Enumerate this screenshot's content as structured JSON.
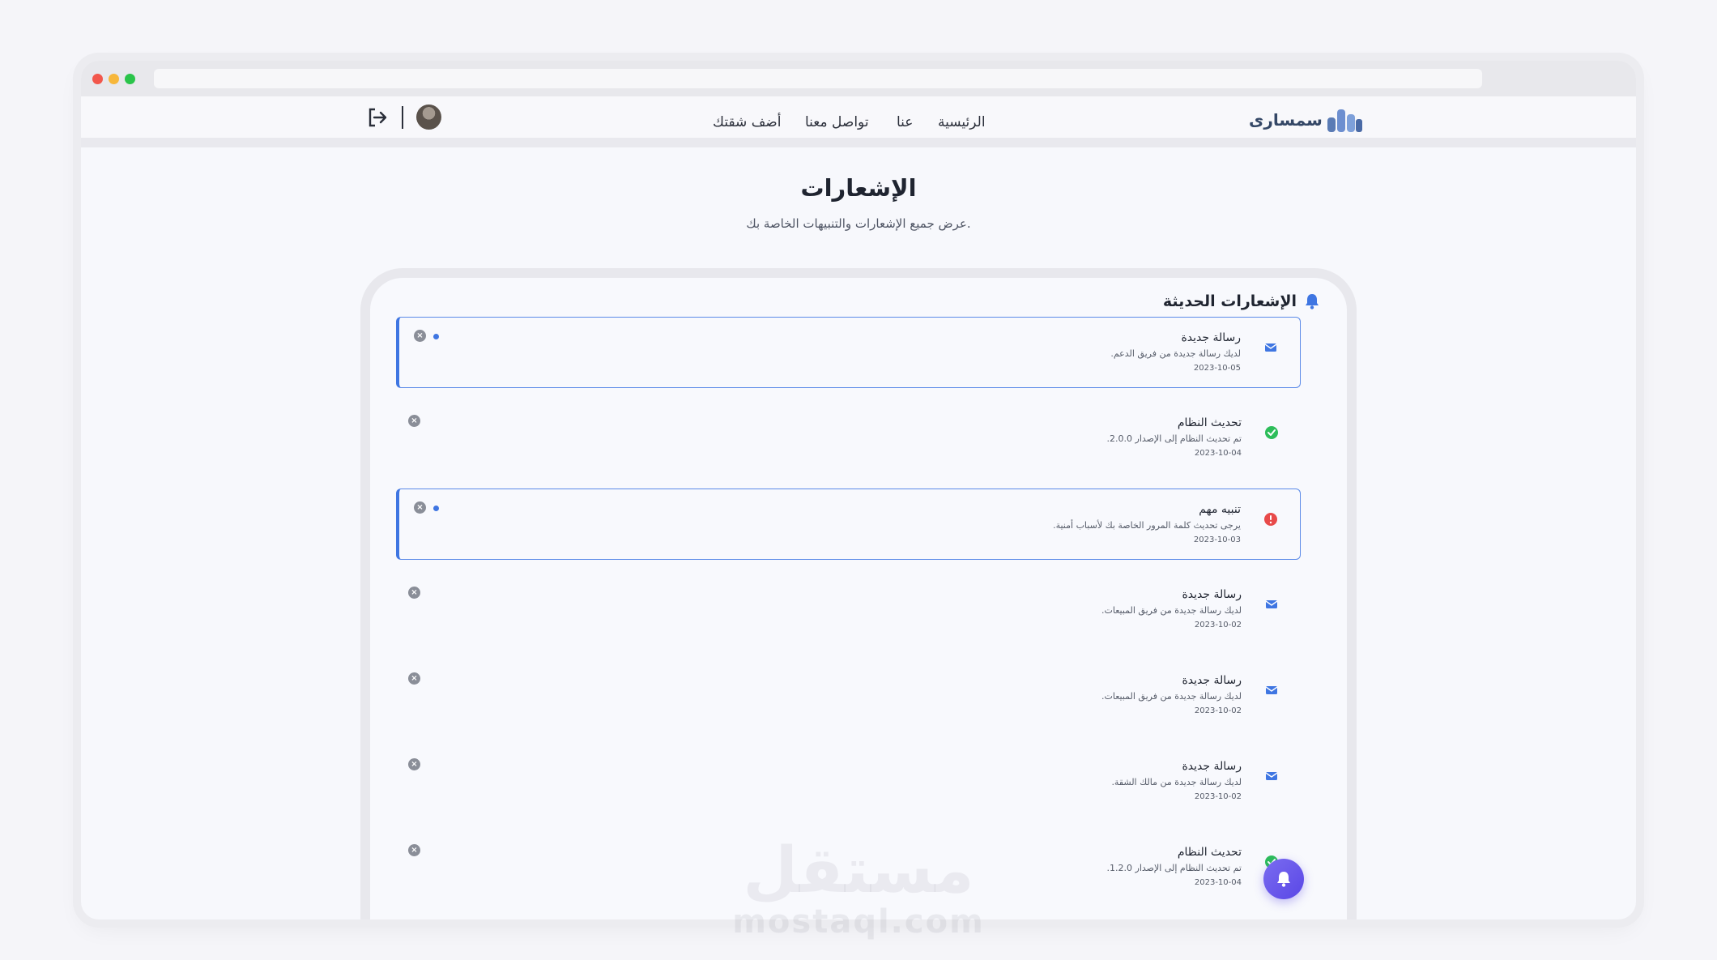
{
  "nav": {
    "logo_text": "سمسارى",
    "links": [
      "الرئيسية",
      "عنا",
      "تواصل معنا",
      "أضف شقتك"
    ]
  },
  "page": {
    "title": "الإشعارات",
    "subtitle": "عرض جميع الإشعارات والتنبيهات الخاصة بك."
  },
  "card": {
    "title": "الإشعارات الحديثة"
  },
  "notifications": [
    {
      "type": "message",
      "title": "رسالة جديدة",
      "body": "لديك رسالة جديدة من فريق الدعم.",
      "date": "2023-10-05",
      "unread": true
    },
    {
      "type": "success",
      "title": "تحديث النظام",
      "body": "تم تحديث النظام إلى الإصدار 2.0.0.",
      "date": "2023-10-04",
      "unread": false
    },
    {
      "type": "alert",
      "title": "تنبيه مهم",
      "body": "يرجى تحديث كلمة المرور الخاصة بك لأسباب أمنية.",
      "date": "2023-10-03",
      "unread": true
    },
    {
      "type": "message",
      "title": "رسالة جديدة",
      "body": "لديك رسالة جديدة من فريق المبيعات.",
      "date": "2023-10-02",
      "unread": false
    },
    {
      "type": "message",
      "title": "رسالة جديدة",
      "body": "لديك رسالة جديدة من فريق المبيعات.",
      "date": "2023-10-02",
      "unread": false
    },
    {
      "type": "message",
      "title": "رسالة جديدة",
      "body": "لديك رسالة جديدة من مالك الشقة.",
      "date": "2023-10-02",
      "unread": false
    },
    {
      "type": "success",
      "title": "تحديث النظام",
      "body": "تم تحديث النظام إلى الإصدار 1.2.0.",
      "date": "2023-10-04",
      "unread": false
    }
  ],
  "watermark": {
    "arabic": "مستقل",
    "latin": "mostaql.com"
  },
  "colors": {
    "accent": "#3f76e2",
    "success": "#2dbd5a",
    "danger": "#e84a4a",
    "fab": "#6a5ae8"
  }
}
